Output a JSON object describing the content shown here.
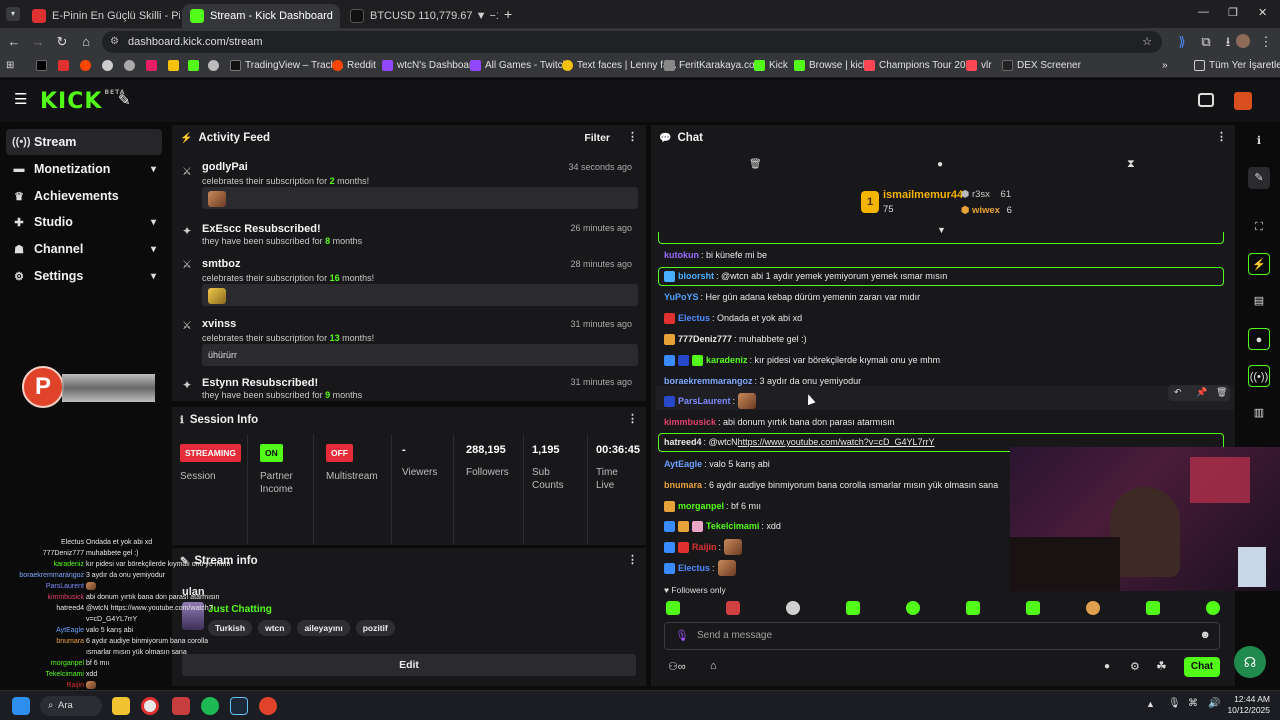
{
  "browser": {
    "tabs": [
      {
        "label": "E-Pinin En Güçlü Skilli - Pindirim",
        "active": false,
        "color": "#e0302f"
      },
      {
        "label": "Stream - Kick Dashboard",
        "active": true,
        "color": "#53fc18"
      },
      {
        "label": "BTCUSD 110,779.67 ▼ −1.95%",
        "active": false,
        "color": "#222"
      }
    ],
    "url": "dashboard.kick.com/stream",
    "bookmarks": [
      "TradingView – Track...",
      "Reddit",
      "wtcN's Dashboard",
      "All Games - Twitch",
      "Text faces | Lenny fa...",
      "FeritKarakaya.com",
      "Kick",
      "Browse | kick",
      "Champions Tour 20...",
      "vlr",
      "DEX Screener"
    ],
    "all_bookmarks": "Tüm Yer İşaretleri"
  },
  "kick": {
    "logo": "KICK",
    "beta": "BETA",
    "accent": "#53fc18"
  },
  "sidebar": {
    "items": [
      {
        "label": "Stream",
        "icon": "broadcast-icon",
        "active": true
      },
      {
        "label": "Monetization",
        "icon": "money-icon",
        "chevron": true
      },
      {
        "label": "Achievements",
        "icon": "trophy-icon"
      },
      {
        "label": "Studio",
        "icon": "studio-icon",
        "chevron": true
      },
      {
        "label": "Channel",
        "icon": "channel-icon",
        "chevron": true
      },
      {
        "label": "Settings",
        "icon": "gear-icon",
        "chevron": true
      }
    ]
  },
  "activity": {
    "title": "Activity Feed",
    "filter": "Filter",
    "items": [
      {
        "name": "godlyPai",
        "sub_pre": "celebrates their subscription for ",
        "num": "2",
        "sub_post": " months!",
        "time": "34 seconds ago",
        "msg": ""
      },
      {
        "name": "ExEscc Resubscribed!",
        "sub_pre": "they have been subscribed for ",
        "num": "8",
        "sub_post": " months",
        "time": "26 minutes ago",
        "msg": null
      },
      {
        "name": "smtboz",
        "sub_pre": "celebrates their subscription for ",
        "num": "16",
        "sub_post": " months!",
        "time": "28 minutes ago",
        "msg": ""
      },
      {
        "name": "xvinss",
        "sub_pre": "celebrates their subscription for ",
        "num": "13",
        "sub_post": " months!",
        "time": "31 minutes ago",
        "msg": "ühürürr"
      },
      {
        "name": "Estynn Resubscribed!",
        "sub_pre": "they have been subscribed for ",
        "num": "9",
        "sub_post": " months",
        "time": "31 minutes ago",
        "msg": null
      }
    ]
  },
  "session": {
    "title": "Session Info",
    "cols": [
      {
        "badge": "STREAMING",
        "badge_color": "#e62c3b",
        "label": "Session"
      },
      {
        "badge": "ON",
        "badge_color": "#53fc18",
        "label": "Partner\nIncome"
      },
      {
        "badge": "OFF",
        "badge_color": "#e62c3b",
        "label": "Multistream"
      },
      {
        "value": "-",
        "label": "Viewers"
      },
      {
        "value": "288,195",
        "label": "Followers"
      },
      {
        "value": "1,195",
        "label": "Sub\nCounts"
      },
      {
        "value": "00:36:45",
        "label": "Time\nLive"
      }
    ]
  },
  "stream_info": {
    "title": "Stream info",
    "stream_title": "ulan",
    "category": "Just Chatting",
    "tags": [
      "Turkish",
      "wtcn",
      "aileyayını",
      "pozitif"
    ],
    "edit": "Edit"
  },
  "chat": {
    "title": "Chat",
    "top": {
      "user": "ismailmemur44",
      "user_score": "75",
      "rank": "1",
      "second": "r3sx",
      "second_score": "61",
      "third": "wiwex",
      "third_score": "6"
    },
    "messages": [
      {
        "user": "kutokun",
        "color": "#9b6bff",
        "text": ": bi künefe mi be"
      },
      {
        "user": "bloorsht",
        "color": "#48b0ff",
        "text": ": @wtcn abi 1 aydır yemek yemiyorum yemek ısmar mısın",
        "highlight": true
      },
      {
        "user": "YuPoYS",
        "color": "#4fa3ff",
        "text": ": Her gün adana kebap dürüm yemenin zararı var mıdır"
      },
      {
        "user": "Electus",
        "color": "#4f8bff",
        "text": ": Ondada et yok abi xd"
      },
      {
        "user": "777Deniz777",
        "color": "#e8e8e8",
        "text": ": muhabbete gel :)"
      },
      {
        "user": "karadeniz",
        "color": "#53fc18",
        "text": ": kır pidesi var börekçilerde kıymalı onu ye mhm"
      },
      {
        "user": "boraekremmarangoz",
        "color": "#7fa8ff",
        "text": ": 3 aydır da onu yemiyodur"
      },
      {
        "user": "ParsLaurent",
        "color": "#7f8bff",
        "text": ":"
      },
      {
        "user": "kimmbusick",
        "color": "#e0406a",
        "text": ": abi donum yırtık bana don parası atarmısın"
      },
      {
        "user": "hatreed4",
        "color": "#e8e8e8",
        "text": ": @wtcN ",
        "link": "https://www.youtube.com/watch?v=cD_G4YL7rrY",
        "highlight": true
      },
      {
        "user": "AytEagle",
        "color": "#6ea0ff",
        "text": ": valo 5 karış abi"
      },
      {
        "user": "bnumara",
        "color": "#e8a23a",
        "text": ": 6 aydır audiye binmiyorum bana corolla ısmarlar mısın yük olmasın sana"
      },
      {
        "user": "morganpel",
        "color": "#53fc18",
        "text": ": bf 6 mıı"
      },
      {
        "user": "Tekelcimami",
        "color": "#53fc18",
        "text": ": xdd"
      },
      {
        "user": "Raijin",
        "color": "#e0302f",
        "text": ":"
      },
      {
        "user": "Electus",
        "color": "#4f8bff",
        "text": ":"
      }
    ],
    "followers_only": "Followers only",
    "placeholder": "Send a message",
    "send": "Chat"
  },
  "overlay": {
    "lines": [
      {
        "u": "Electus",
        "c": "#4f8bff",
        "t": "Ondada et yok abi xd"
      },
      {
        "u": "777Deniz777",
        "c": "#eee",
        "t": "muhabbete gel :)"
      },
      {
        "u": "karadeniz",
        "c": "#53fc18",
        "t": "kır pidesi var börekçilerde kıymalı onu ye mhm"
      },
      {
        "u": "boraekremmarangoz",
        "c": "#7fa8ff",
        "t": "3 aydır da onu yemiyodur"
      },
      {
        "u": "ParsLaurent",
        "c": "#7f8bff",
        "t": ""
      },
      {
        "u": "kimmbusick",
        "c": "#e0406a",
        "t": "abi donum yırtık bana don parası atarmısın"
      },
      {
        "u": "hatreed4",
        "c": "#eee",
        "t": "@wtcN https://www.youtube.com/watch?"
      },
      {
        "u": "",
        "c": "#eee",
        "t": "v=cD_G4YL7rrY"
      },
      {
        "u": "AytEagle",
        "c": "#6ea0ff",
        "t": "valo 5 karış abi"
      },
      {
        "u": "bnumara",
        "c": "#e8a23a",
        "t": "6 aydır audiye binmiyorum bana corolla"
      },
      {
        "u": "",
        "c": "#eee",
        "t": "ısmarlar mısın yük olmasın sana"
      },
      {
        "u": "morganpel",
        "c": "#53fc18",
        "t": "bf 6 mıı"
      },
      {
        "u": "Tekelcimami",
        "c": "#53fc18",
        "t": "xdd"
      },
      {
        "u": "Raijin",
        "c": "#e0302f",
        "t": ""
      }
    ]
  },
  "taskbar": {
    "search": "Ara",
    "time": "12:44 AM",
    "date": "10/12/2025"
  }
}
